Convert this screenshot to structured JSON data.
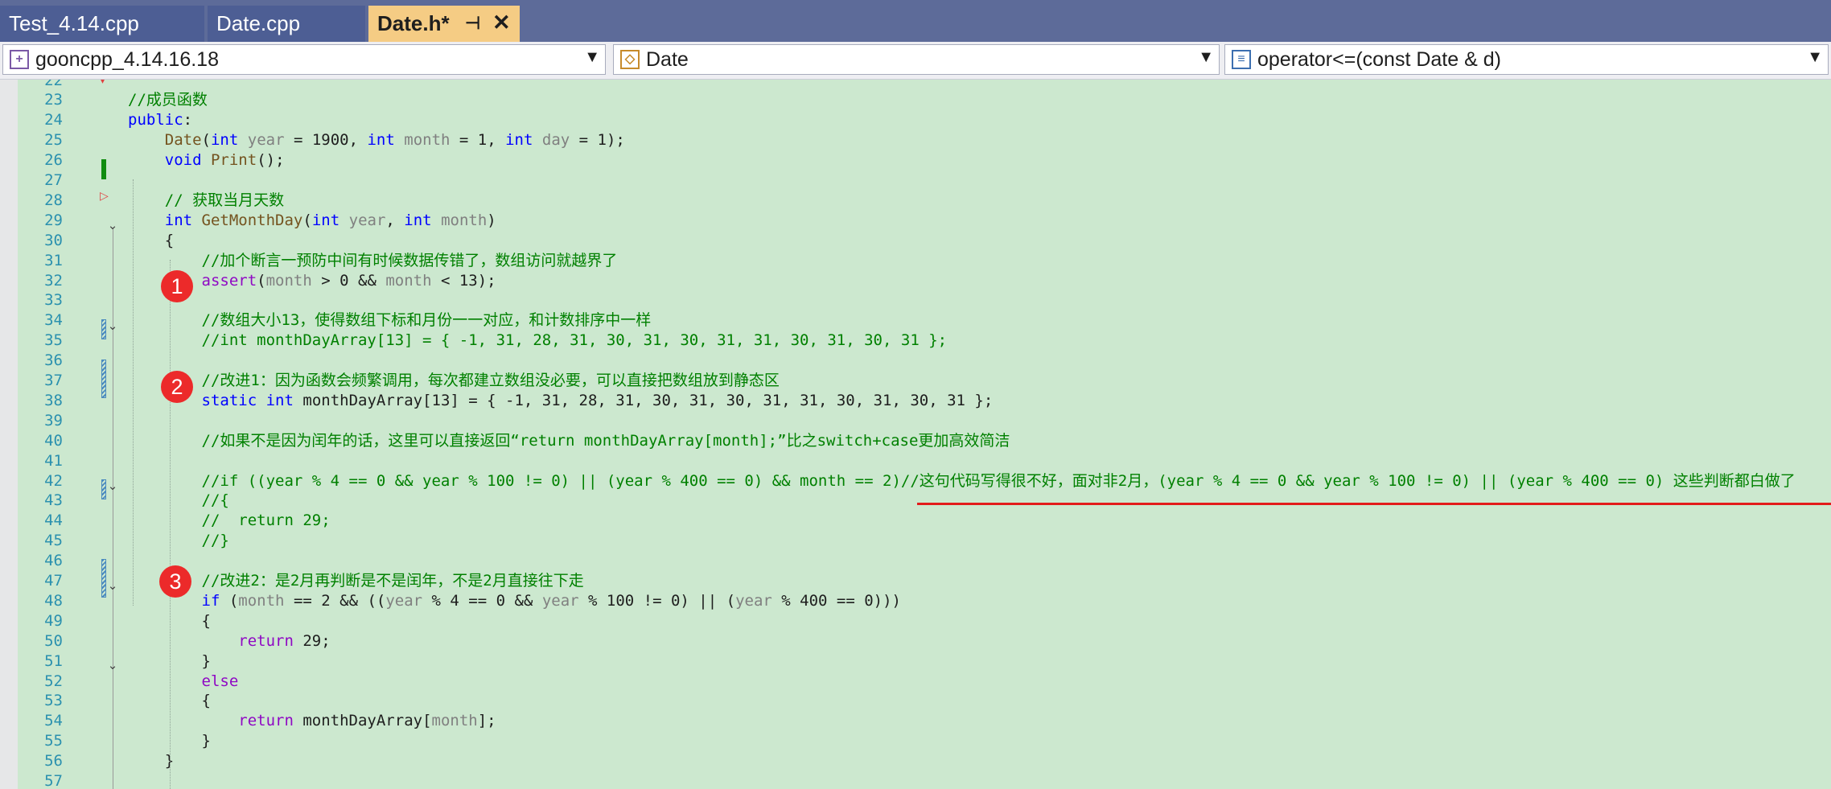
{
  "tabs": [
    {
      "label": "Test_4.14.cpp",
      "active": false
    },
    {
      "label": "Date.cpp",
      "active": false
    },
    {
      "label": "Date.h*",
      "active": true
    }
  ],
  "tab_icons": {
    "pin": "pin-icon",
    "close": "close-icon"
  },
  "nav": {
    "project": "gooncpp_4.14.16.18",
    "scope": "Date",
    "member": "operator<=(const Date & d)"
  },
  "badges": [
    "1",
    "2",
    "3"
  ],
  "line_numbers": [
    "22",
    "23",
    "24",
    "25",
    "26",
    "27",
    "28",
    "29",
    "30",
    "31",
    "32",
    "33",
    "34",
    "35",
    "36",
    "37",
    "38",
    "39",
    "40",
    "41",
    "42",
    "43",
    "44",
    "45",
    "46",
    "47",
    "48",
    "49",
    "50",
    "51",
    "52",
    "53",
    "54",
    "55",
    "56",
    "57"
  ],
  "code_lines": [
    [],
    [
      {
        "t": "//成员函数",
        "c": "cm"
      }
    ],
    [
      {
        "t": "public",
        "c": "kw"
      },
      {
        "t": ":",
        "c": ""
      }
    ],
    [
      {
        "t": "    ",
        "c": ""
      },
      {
        "t": "Date",
        "c": "fn"
      },
      {
        "t": "(",
        "c": ""
      },
      {
        "t": "int",
        "c": "kw"
      },
      {
        "t": " ",
        "c": ""
      },
      {
        "t": "year",
        "c": "pr"
      },
      {
        "t": " = 1900, ",
        "c": ""
      },
      {
        "t": "int",
        "c": "kw"
      },
      {
        "t": " ",
        "c": ""
      },
      {
        "t": "month",
        "c": "pr"
      },
      {
        "t": " = 1, ",
        "c": ""
      },
      {
        "t": "int",
        "c": "kw"
      },
      {
        "t": " ",
        "c": ""
      },
      {
        "t": "day",
        "c": "pr"
      },
      {
        "t": " = 1);",
        "c": ""
      }
    ],
    [
      {
        "t": "    ",
        "c": ""
      },
      {
        "t": "void",
        "c": "kw"
      },
      {
        "t": " ",
        "c": ""
      },
      {
        "t": "Print",
        "c": "fn"
      },
      {
        "t": "();",
        "c": ""
      }
    ],
    [],
    [
      {
        "t": "    ",
        "c": ""
      },
      {
        "t": "// 获取当月天数",
        "c": "cm"
      }
    ],
    [
      {
        "t": "    ",
        "c": ""
      },
      {
        "t": "int",
        "c": "kw"
      },
      {
        "t": " ",
        "c": ""
      },
      {
        "t": "GetMonthDay",
        "c": "fn"
      },
      {
        "t": "(",
        "c": ""
      },
      {
        "t": "int",
        "c": "kw"
      },
      {
        "t": " ",
        "c": ""
      },
      {
        "t": "year",
        "c": "pr"
      },
      {
        "t": ", ",
        "c": ""
      },
      {
        "t": "int",
        "c": "kw"
      },
      {
        "t": " ",
        "c": ""
      },
      {
        "t": "month",
        "c": "pr"
      },
      {
        "t": ")",
        "c": ""
      }
    ],
    [
      {
        "t": "    {",
        "c": ""
      }
    ],
    [
      {
        "t": "        ",
        "c": ""
      },
      {
        "t": "//加个断言一预防中间有时候数据传错了，数组访问就越界了",
        "c": "cm"
      }
    ],
    [
      {
        "t": "        ",
        "c": ""
      },
      {
        "t": "assert",
        "c": "ma"
      },
      {
        "t": "(",
        "c": ""
      },
      {
        "t": "month",
        "c": "pr"
      },
      {
        "t": " > 0 && ",
        "c": ""
      },
      {
        "t": "month",
        "c": "pr"
      },
      {
        "t": " < 13);",
        "c": ""
      }
    ],
    [],
    [
      {
        "t": "        ",
        "c": ""
      },
      {
        "t": "//数组大小13，使得数组下标和月份一一对应，和计数排序中一样",
        "c": "cm"
      }
    ],
    [
      {
        "t": "        ",
        "c": ""
      },
      {
        "t": "//int monthDayArray[13] = { -1, 31, 28, 31, 30, 31, 30, 31, 31, 30, 31, 30, 31 };",
        "c": "cm"
      }
    ],
    [],
    [
      {
        "t": "        ",
        "c": ""
      },
      {
        "t": "//改进1：因为函数会频繁调用，每次都建立数组没必要，可以直接把数组放到静态区",
        "c": "cm"
      }
    ],
    [
      {
        "t": "        ",
        "c": ""
      },
      {
        "t": "static",
        "c": "kw"
      },
      {
        "t": " ",
        "c": ""
      },
      {
        "t": "int",
        "c": "kw"
      },
      {
        "t": " monthDayArray[13] = { -1, 31, 28, 31, 30, 31, 30, 31, 31, 30, 31, 30, 31 };",
        "c": ""
      }
    ],
    [],
    [
      {
        "t": "        ",
        "c": ""
      },
      {
        "t": "//如果不是因为闰年的话，这里可以直接返回“return monthDayArray[month];”比之switch+case更加高效简洁",
        "c": "cm"
      }
    ],
    [],
    [
      {
        "t": "        ",
        "c": ""
      },
      {
        "t": "//if ((year % 4 == 0 && year % 100 != 0) || (year % 400 == 0) && month == 2)//这句代码写得很不好，面对非2月，(year % 4 == 0 && year % 100 != 0) || (year % 400 == 0) 这些判断都白做了",
        "c": "cm"
      }
    ],
    [
      {
        "t": "        ",
        "c": ""
      },
      {
        "t": "//{",
        "c": "cm"
      }
    ],
    [
      {
        "t": "        ",
        "c": ""
      },
      {
        "t": "//  return 29;",
        "c": "cm"
      }
    ],
    [
      {
        "t": "        ",
        "c": ""
      },
      {
        "t": "//}",
        "c": "cm"
      }
    ],
    [],
    [
      {
        "t": "        ",
        "c": ""
      },
      {
        "t": "//改进2：是2月再判断是不是闰年，不是2月直接往下走",
        "c": "cm"
      }
    ],
    [
      {
        "t": "        ",
        "c": ""
      },
      {
        "t": "if",
        "c": "kw"
      },
      {
        "t": " (",
        "c": ""
      },
      {
        "t": "month",
        "c": "pr"
      },
      {
        "t": " == 2 && ((",
        "c": ""
      },
      {
        "t": "year",
        "c": "pr"
      },
      {
        "t": " % 4 == 0 && ",
        "c": ""
      },
      {
        "t": "year",
        "c": "pr"
      },
      {
        "t": " % 100 != 0) || (",
        "c": ""
      },
      {
        "t": "year",
        "c": "pr"
      },
      {
        "t": " % 400 == 0)))",
        "c": ""
      }
    ],
    [
      {
        "t": "        {",
        "c": ""
      }
    ],
    [
      {
        "t": "            ",
        "c": ""
      },
      {
        "t": "return",
        "c": "ma"
      },
      {
        "t": " 29;",
        "c": ""
      }
    ],
    [
      {
        "t": "        }",
        "c": ""
      }
    ],
    [
      {
        "t": "        ",
        "c": ""
      },
      {
        "t": "else",
        "c": "ma"
      }
    ],
    [
      {
        "t": "        {",
        "c": ""
      }
    ],
    [
      {
        "t": "            ",
        "c": ""
      },
      {
        "t": "return",
        "c": "ma"
      },
      {
        "t": " monthDayArray[",
        "c": ""
      },
      {
        "t": "month",
        "c": "pr"
      },
      {
        "t": "];",
        "c": ""
      }
    ],
    [
      {
        "t": "        }",
        "c": ""
      }
    ],
    [
      {
        "t": "    }",
        "c": ""
      }
    ],
    []
  ]
}
